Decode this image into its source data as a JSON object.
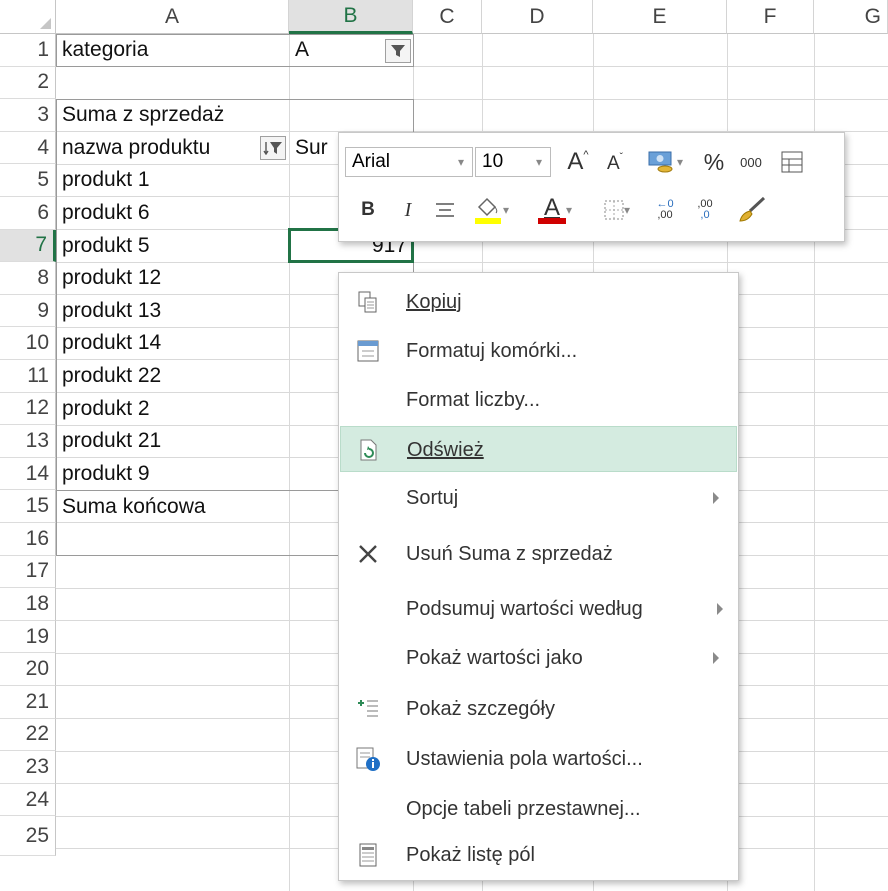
{
  "columns": [
    "A",
    "B",
    "C",
    "D",
    "E",
    "F",
    "G"
  ],
  "rows": [
    "1",
    "2",
    "3",
    "4",
    "5",
    "6",
    "7",
    "8",
    "9",
    "10",
    "11",
    "12",
    "13",
    "14",
    "15",
    "16",
    "17",
    "18",
    "19",
    "20",
    "21",
    "22",
    "23",
    "24",
    "25"
  ],
  "cells": {
    "a1": "kategoria",
    "b1": "A",
    "a3": "Suma z sprzedaż",
    "a4": "nazwa produktu",
    "b4": "Sur",
    "a5": "produkt 1",
    "a6": "produkt 6",
    "a7": "produkt 5",
    "b7": "917",
    "a8": "produkt 12",
    "a9": "produkt 13",
    "a10": "produkt 14",
    "a11": "produkt 22",
    "a12": "produkt 2",
    "a13": "produkt 21",
    "a14": "produkt 9",
    "a15": "Suma końcowa"
  },
  "mini_toolbar": {
    "font_name": "Arial",
    "font_size": "10",
    "grow_font": "A",
    "shrink_font": "A",
    "percent": "%",
    "thousands": "000",
    "bold": "B",
    "italic": "I",
    "font_color_letter": "A",
    "inc_decimal": ",00",
    "dec_decimal": ",0",
    "accent_fill": "#ffff00",
    "accent_font": "#d00000"
  },
  "context_menu": {
    "items": [
      {
        "label": "Kopiuj"
      },
      {
        "label": "Formatuj komórki..."
      },
      {
        "label": "Format liczby..."
      },
      {
        "label": "Odśwież"
      },
      {
        "label": "Sortuj"
      },
      {
        "label": "Usuń Suma z sprzedaż"
      },
      {
        "label": "Podsumuj wartości według"
      },
      {
        "label": "Pokaż wartości jako"
      },
      {
        "label": "Pokaż szczegóły"
      },
      {
        "label": "Ustawienia pola wartości..."
      },
      {
        "label": "Opcje tabeli przestawnej..."
      },
      {
        "label": "Pokaż listę pól"
      }
    ]
  },
  "colors": {
    "excel_green": "#217346",
    "menu_highlight": "#d4ebe0"
  }
}
